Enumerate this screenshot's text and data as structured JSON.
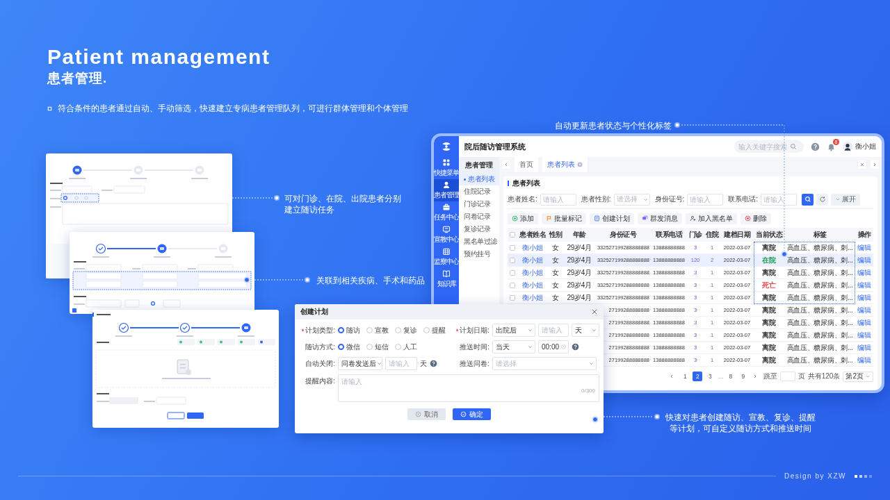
{
  "headline": {
    "title": "Patient management",
    "subtitle": "患者管理.",
    "description": "符合条件的患者通过自动、手动筛选，快速建立专病患者管理队列，可进行群体管理和个体管理"
  },
  "form_mockups": [
    {
      "kind": "task-basics",
      "steps": [
        {
          "done": false,
          "current": true
        },
        {
          "done": false,
          "current": false
        },
        {
          "done": false,
          "current": false
        }
      ]
    },
    {
      "kind": "filters",
      "steps": [
        {
          "done": true,
          "current": false
        },
        {
          "done": false,
          "current": true
        },
        {
          "done": false,
          "current": false
        }
      ]
    },
    {
      "kind": "task-content",
      "steps": [
        {
          "done": true,
          "current": false
        },
        {
          "done": true,
          "current": false
        },
        {
          "done": false,
          "current": true
        }
      ]
    }
  ],
  "callouts": [
    {
      "lines": [
        "可对门诊、在院、出院患者分别",
        "建立随访任务"
      ]
    },
    {
      "lines": [
        "关联到相关疾病、手术和药品"
      ]
    },
    {
      "lines": [
        "快速对患者创建随访、宣教、复诊、提醒",
        "等计划，可自定义随访方式和推送时间"
      ]
    },
    {
      "lines": [
        "自动更新患者状态与个性化标签"
      ]
    }
  ],
  "patient_window": {
    "app_title": "院后随访管理系统",
    "search_placeholder": "输入关键字搜索",
    "notification_count": "8",
    "user_name": "衡小姐",
    "rail": [
      {
        "label": "快捷菜单",
        "selected": false
      },
      {
        "label": "患者管理",
        "selected": true
      },
      {
        "label": "任务中心",
        "selected": false
      },
      {
        "label": "宣教中心",
        "selected": false
      },
      {
        "label": "监察中心",
        "selected": false
      },
      {
        "label": "知识库",
        "selected": false
      }
    ],
    "submenu": {
      "title": "患者管理",
      "items": [
        {
          "label": "患者列表",
          "selected": true
        },
        {
          "label": "住院记录",
          "selected": false
        },
        {
          "label": "门诊记录",
          "selected": false
        },
        {
          "label": "问卷记录",
          "selected": false
        },
        {
          "label": "复诊记录",
          "selected": false
        },
        {
          "label": "黑名单过滤",
          "selected": false
        },
        {
          "label": "预约挂号",
          "selected": false
        }
      ]
    },
    "tabs": [
      {
        "label": "首页",
        "selected": false,
        "closable": false
      },
      {
        "label": "患者列表",
        "selected": true,
        "closable": true
      }
    ],
    "section_title": "患者列表",
    "filters": [
      {
        "label": "患者姓名:",
        "kind": "input",
        "placeholder": "请输入"
      },
      {
        "label": "患者性别:",
        "kind": "select",
        "placeholder": "请选择"
      },
      {
        "label": "身份证号:",
        "kind": "input",
        "placeholder": "请输入"
      },
      {
        "label": "联系电话:",
        "kind": "input",
        "placeholder": "请输入"
      }
    ],
    "expand_button": "展开",
    "actions": [
      "添加",
      "批量标记",
      "创建计划",
      "群发消息",
      "加入黑名单",
      "删除"
    ],
    "select_all_checked": false,
    "columns": [
      "患者姓名",
      "性别",
      "年龄",
      "身份证号",
      "联系电话",
      "门诊",
      "住院",
      "建档日期",
      "当前状态",
      "标签",
      "操作"
    ],
    "rows": [
      {
        "selected": false,
        "checked": false,
        "name": "衡小姐",
        "sex": "女",
        "age": "29岁4月",
        "id_number": "332527199288888888",
        "phone": "13888888888",
        "outpatient": "3",
        "inpatient": "1",
        "created": "2022-03-07",
        "status": {
          "text": "离院",
          "color": "#333333"
        },
        "tags": "高血压、糖尿病、刺...",
        "action": "编辑"
      },
      {
        "selected": true,
        "checked": false,
        "name": "衡小姐",
        "sex": "女",
        "age": "29岁4月",
        "id_number": "332527199288888888",
        "phone": "13888888888",
        "outpatient": "120",
        "inpatient": "2",
        "created": "2022-03-07",
        "status": {
          "text": "在院",
          "color": "#1f9d55"
        },
        "tags": "高血压、糖尿病、刺...",
        "action": "编辑"
      },
      {
        "selected": false,
        "checked": false,
        "name": "衡小姐",
        "sex": "女",
        "age": "29岁4月",
        "id_number": "332527199288888888",
        "phone": "13888888888",
        "outpatient": "3",
        "inpatient": "1",
        "created": "2022-03-07",
        "status": {
          "text": "离院",
          "color": "#333333"
        },
        "tags": "高血压、糖尿病、刺...",
        "action": "编辑"
      },
      {
        "selected": false,
        "checked": false,
        "name": "衡小姐",
        "sex": "女",
        "age": "29岁4月",
        "id_number": "332527199288888888",
        "phone": "13888888888",
        "outpatient": "3",
        "inpatient": "1",
        "created": "2022-03-07",
        "status": {
          "text": "死亡",
          "color": "#e5484d"
        },
        "tags": "高血压、糖尿病、刺...",
        "action": "编辑"
      },
      {
        "selected": false,
        "checked": false,
        "name": "衡小姐",
        "sex": "女",
        "age": "29岁4月",
        "id_number": "332527199288888888",
        "phone": "13888888888",
        "outpatient": "3",
        "inpatient": "1",
        "created": "2022-03-07",
        "status": {
          "text": "离院",
          "color": "#333333"
        },
        "tags": "高血压、糖尿病、刺...",
        "action": "编辑"
      },
      {
        "selected": false,
        "id_number": "27199288888888",
        "phone": "13888888888",
        "outpatient": "3",
        "inpatient": "1",
        "created": "2022-03-07",
        "status": {
          "text": "离院",
          "color": "#333333"
        },
        "tags": "高血压、糖尿病、刺...",
        "action": "编辑"
      },
      {
        "selected": false,
        "id_number": "27199288888888",
        "phone": "13888888888",
        "outpatient": "3",
        "inpatient": "1",
        "created": "2022-03-07",
        "status": {
          "text": "离院",
          "color": "#333333"
        },
        "tags": "高血压、糖尿病、刺...",
        "action": "编辑"
      },
      {
        "selected": false,
        "id_number": "27199288888888",
        "phone": "13888888888",
        "outpatient": "3",
        "inpatient": "1",
        "created": "2022-03-07",
        "status": {
          "text": "离院",
          "color": "#333333"
        },
        "tags": "高血压、糖尿病、刺...",
        "action": "编辑"
      },
      {
        "selected": false,
        "id_number": "27199288888888",
        "phone": "13888888888",
        "outpatient": "3",
        "inpatient": "1",
        "created": "2022-03-07",
        "status": {
          "text": "离院",
          "color": "#333333"
        },
        "tags": "高血压、糖尿病、刺...",
        "action": "编辑"
      },
      {
        "selected": false,
        "id_number": "27199288888888",
        "phone": "13888888888",
        "outpatient": "3",
        "inpatient": "1",
        "created": "2022-03-07",
        "status": {
          "text": "离院",
          "color": "#333333"
        },
        "tags": "高血压、糖尿病、刺...",
        "action": "编辑"
      }
    ],
    "pagination": {
      "pages": [
        {
          "kind": "page",
          "label": "1",
          "selected": false
        },
        {
          "kind": "page",
          "label": "2",
          "selected": true
        },
        {
          "kind": "page",
          "label": "3",
          "selected": false
        },
        {
          "kind": "ellipsis",
          "label": "......"
        },
        {
          "kind": "page",
          "label": "8",
          "selected": false
        },
        {
          "kind": "page",
          "label": "9",
          "selected": false
        }
      ],
      "jump_label": "跳至",
      "page_suffix": "页",
      "total": "共有120条",
      "page_select": "第2页"
    }
  },
  "plan_dialog": {
    "title": "创建计划",
    "plan_type": {
      "label": "计划类型:",
      "required": true,
      "options": [
        {
          "label": "随访",
          "selected": true
        },
        {
          "label": "宣教",
          "selected": false
        },
        {
          "label": "复诊",
          "selected": false
        },
        {
          "label": "提醒",
          "selected": false
        }
      ]
    },
    "method": {
      "label": "随访方式:",
      "required": false,
      "options": [
        {
          "label": "微信",
          "selected": true
        },
        {
          "label": "短信",
          "selected": false
        },
        {
          "label": "人工",
          "selected": false
        }
      ]
    },
    "auto_close": {
      "label": "自动关闭:",
      "required": false,
      "select": "问卷发送后",
      "input_placeholder": "请输入",
      "unit": "天"
    },
    "plan_date": {
      "label": "计划日期:",
      "required": true,
      "select": "出院后",
      "input_placeholder": "请输入",
      "unit_select": "天"
    },
    "push_time": {
      "label": "推送时间:",
      "required": false,
      "select": "当天",
      "time": "00:00"
    },
    "questionnaire": {
      "label": "推送问卷:",
      "required": false,
      "placeholder": "请选择"
    },
    "reminder": {
      "label": "提醒内容:",
      "required": false,
      "placeholder": "请输入",
      "counter": "0/300"
    },
    "buttons": [
      {
        "label": "取消",
        "kind": "secondary"
      },
      {
        "label": "确定",
        "kind": "primary"
      }
    ]
  },
  "footer": {
    "credit": "Design by XZW"
  }
}
